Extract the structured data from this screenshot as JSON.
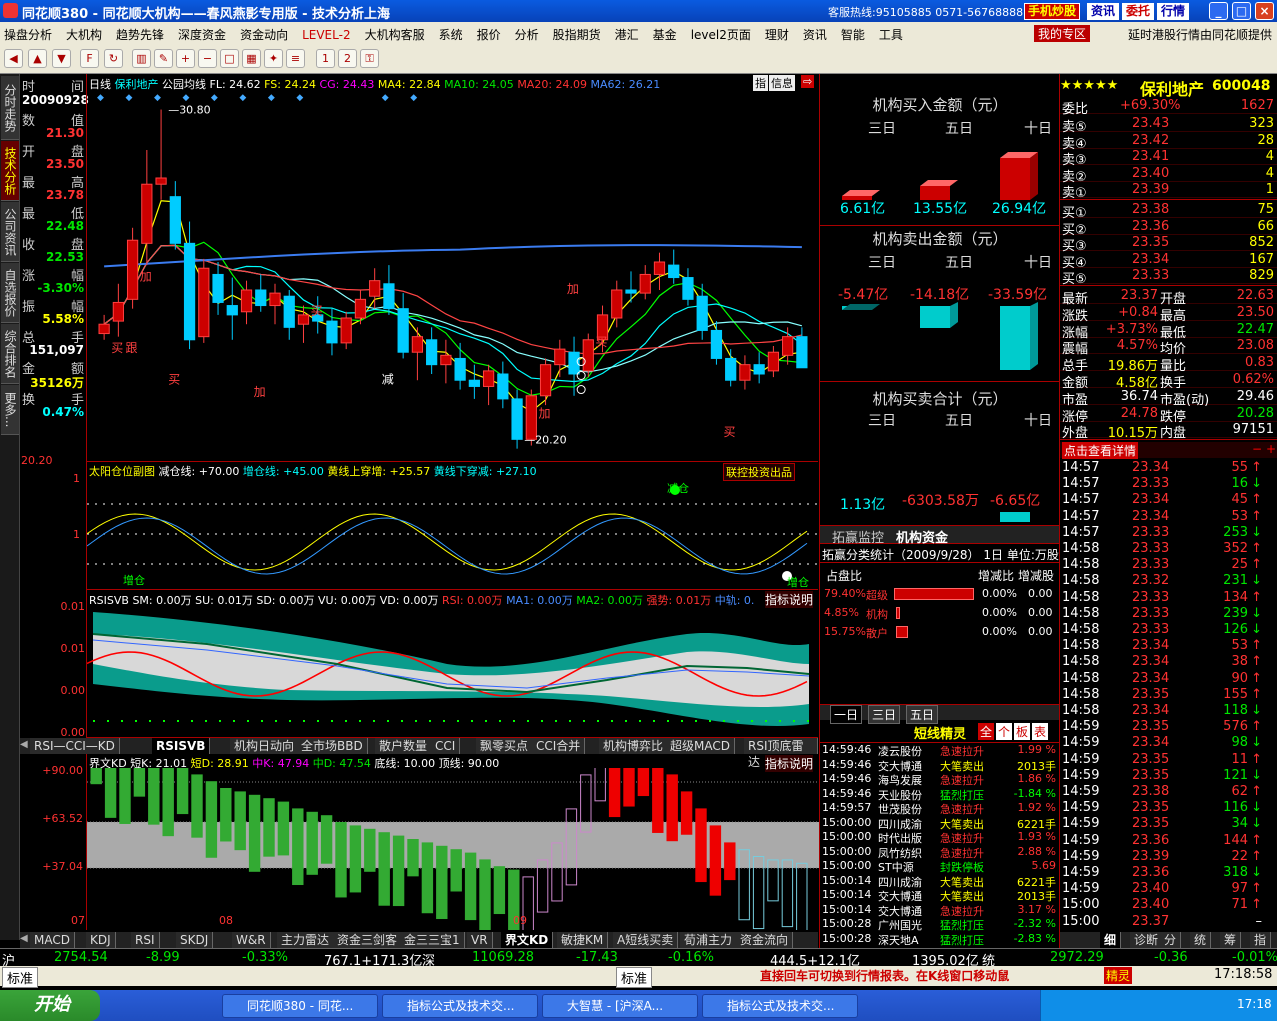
{
  "window": {
    "title": "同花顺380 - 同花顺大机构——春风燕影专用版 - 技术分析上海",
    "hotline": "客服热线:95105885 0571-56768888",
    "btn_phone": "手机炒股",
    "btn_news": "资讯",
    "btn_commission": "委托",
    "btn_quote": "行情",
    "min": "_",
    "max": "□",
    "close": "×"
  },
  "menu": {
    "items": [
      "操盘分析",
      "大机构",
      "趋势先锋",
      "深度资金",
      "资金动向",
      "LEVEL-2",
      "大机构客服",
      "系统",
      "报价",
      "分析",
      "股指期货",
      "港汇",
      "基金",
      "level2页面",
      "理财",
      "资讯",
      "智能",
      "工具"
    ],
    "my_area": "我的专区",
    "right_note": "延时港股行情由同花顺提供"
  },
  "left_tabs": [
    "分时走势",
    "技术分析",
    "公司资讯",
    "自选报价",
    "综合排名",
    "更多..."
  ],
  "info": {
    "date_label_l": "时",
    "date_label_r": "间",
    "date": "20090928",
    "rows": [
      {
        "l": "数",
        "r": "值",
        "v": "21.30"
      },
      {
        "l": "开",
        "r": "盘",
        "v": "23.50"
      },
      {
        "l": "最",
        "r": "高",
        "v": "23.78"
      },
      {
        "l": "最",
        "r": "低",
        "v": "22.48"
      },
      {
        "l": "收",
        "r": "盘",
        "v": "22.53"
      },
      {
        "l": "涨",
        "r": "幅",
        "v": "-3.30%"
      },
      {
        "l": "振",
        "r": "幅",
        "v": "5.58%"
      },
      {
        "l": "总",
        "r": "手",
        "v": "151,097"
      },
      {
        "l": "金",
        "r": "额",
        "v": "35126万"
      },
      {
        "l": "换",
        "r": "手",
        "v": "0.47%"
      }
    ]
  },
  "chart": {
    "period": "日线",
    "stock": "保利地产",
    "indicator": "公园均线",
    "fl": "FL: 24.62",
    "fs": "FS: 24.24",
    "cg": "CG: 24.43",
    "ma4": "MA4: 22.84",
    "ma10": "MA10: 24.05",
    "ma20": "MA20: 24.09",
    "ma62": "MA62: 26.21",
    "btn_index": "指",
    "btn_info": "信息",
    "high_label": "30.80",
    "low_label": "20.20",
    "axis_low": "20.20",
    "markers": [
      "买",
      "跟",
      "加",
      "买",
      "加",
      "买",
      "减",
      "加",
      "加",
      "买",
      "买"
    ]
  },
  "sub1": {
    "title": "太阳仓位副图",
    "jian": "减仓线: +70.00",
    "zeng": "增仓线: +45.00",
    "up": "黄线上穿增: +25.57",
    "down": "黄线下穿减: +27.10",
    "product": "联控投资出品",
    "y_top": "1",
    "y_mid": "1",
    "tag1": "增仓",
    "tag2": "减仓",
    "tag3": "增仓"
  },
  "sub2": {
    "title": "RSISVB",
    "sm": "SM: 0.00万",
    "su": "SU: 0.01万",
    "sd": "SD: 0.00万",
    "vu": "VU: 0.00万",
    "vd": "VD: 0.00万",
    "rsi": "RSI: 0.00万",
    "ma1": "MA1: 0.00万",
    "ma2": "MA2: 0.00万",
    "strong": "强势: 0.01万",
    "mid": "中轨: 0.",
    "help": "指标说明",
    "y": [
      "0.01",
      "0.01",
      "0.00",
      "0.00"
    ]
  },
  "tabs1": [
    "RSI—CCI—KD",
    "RSISVB",
    "机构日动向",
    "全市场BBD",
    "散户数量",
    "CCI",
    "飘零买点",
    "CCI合并",
    "机构博弈比",
    "超级MACD",
    "RSI顶底雷达"
  ],
  "sub3": {
    "title": "界文KD",
    "k": "短K: 21.01",
    "d": "短D: 28.91",
    "mk": "中K: 47.94",
    "md": "中D: 47.54",
    "floor": "底线: 10.00",
    "top": "顶线: 90.00",
    "help": "指标说明",
    "y": [
      "+90.00",
      "+63.52",
      "+37.04"
    ],
    "x": [
      "07",
      "08",
      "09"
    ]
  },
  "tabs2": [
    "MACD",
    "KDJ",
    "RSI",
    "SKDJ",
    "W&R",
    "主力雷达",
    "资金三剑客",
    "金三三宝1",
    "VR",
    "界文KD",
    "敏捷KM",
    "A短线买卖",
    "荀浦主力",
    "资金流向"
  ],
  "middle": {
    "buy_title": "机构买入金额（元）",
    "sell_title": "机构卖出金额（元）",
    "net_title": "机构买卖合计（元）",
    "heads": [
      "三日",
      "五日",
      "十日"
    ],
    "buy": [
      "6.61亿",
      "13.55亿",
      "26.94亿"
    ],
    "sell": [
      "-5.47亿",
      "-14.18亿",
      "-33.59亿"
    ],
    "net": [
      "1.13亿",
      "-6303.58万",
      "-6.65亿"
    ],
    "tab_a": "拓赢监控",
    "tab_b": "机构资金",
    "stat_title": "拓赢分类统计（2009/9/28）",
    "stat_day": "1日",
    "stat_unit": "单位:",
    "stat_unit_v": "万股",
    "col_a": "占盘比",
    "col_b": "增减比",
    "col_c": "增减股",
    "rows": [
      {
        "p": "79.40%",
        "n": "超级",
        "b": "0.00%",
        "c": "0.00"
      },
      {
        "p": "4.85%",
        "n": "机构",
        "b": "0.00%",
        "c": "0.00"
      },
      {
        "p": "15.75%",
        "n": "散户",
        "b": "0.00%",
        "c": "0.00"
      }
    ],
    "dtabs": [
      "一日",
      "三日",
      "五日"
    ],
    "short_title": "短线精灵",
    "short_btns": [
      "全",
      "个",
      "板",
      "表"
    ],
    "short": [
      {
        "t": "14:59:46",
        "n": "凌云股份",
        "a": "急速拉升",
        "v": "1.99 %"
      },
      {
        "t": "14:59:46",
        "n": "交大博通",
        "a": "大笔卖出",
        "v": "2013手"
      },
      {
        "t": "14:59:46",
        "n": "海鸟发展",
        "a": "急速拉升",
        "v": "1.86 %"
      },
      {
        "t": "14:59:46",
        "n": "天业股份",
        "a": "猛烈打压",
        "v": "-1.84 %"
      },
      {
        "t": "14:59:57",
        "n": "世茂股份",
        "a": "急速拉升",
        "v": "1.92 %"
      },
      {
        "t": "15:00:00",
        "n": "四川成渝",
        "a": "大笔卖出",
        "v": "6221手"
      },
      {
        "t": "15:00:00",
        "n": "时代出版",
        "a": "急速拉升",
        "v": "1.93 %"
      },
      {
        "t": "15:00:00",
        "n": "凤竹纺织",
        "a": "急速拉升",
        "v": "2.88 %"
      },
      {
        "t": "15:00:00",
        "n": "ST中源",
        "a": "封跌停板",
        "v": "5.69"
      },
      {
        "t": "15:00:14",
        "n": "四川成渝",
        "a": "大笔卖出",
        "v": "6221手"
      },
      {
        "t": "15:00:14",
        "n": "交大博通",
        "a": "大笔卖出",
        "v": "2013手"
      },
      {
        "t": "15:00:14",
        "n": "交大博通",
        "a": "急速拉升",
        "v": "3.17 %"
      },
      {
        "t": "15:00:28",
        "n": "广州国光",
        "a": "猛烈打压",
        "v": "-2.32 %"
      },
      {
        "t": "15:00:28",
        "n": "深天地A",
        "a": "猛烈打压",
        "v": "-2.83 %"
      }
    ]
  },
  "right": {
    "stars": "★★★★★",
    "name": "保利地产",
    "code": "600048",
    "weibi_l": "委比",
    "weibi_v": "+69.30%",
    "weibi_n": "1627",
    "sell": [
      {
        "l": "卖⑤",
        "p": "23.43",
        "v": "323"
      },
      {
        "l": "卖④",
        "p": "23.42",
        "v": "28"
      },
      {
        "l": "卖③",
        "p": "23.41",
        "v": "4"
      },
      {
        "l": "卖②",
        "p": "23.40",
        "v": "4"
      },
      {
        "l": "卖①",
        "p": "23.39",
        "v": "1"
      }
    ],
    "buy": [
      {
        "l": "买①",
        "p": "23.38",
        "v": "75"
      },
      {
        "l": "买②",
        "p": "23.36",
        "v": "66"
      },
      {
        "l": "买③",
        "p": "23.35",
        "v": "852"
      },
      {
        "l": "买④",
        "p": "23.34",
        "v": "167"
      },
      {
        "l": "买⑤",
        "p": "23.33",
        "v": "829"
      }
    ],
    "stats": [
      {
        "a": "最新",
        "b": "23.37",
        "c": "开盘",
        "d": "22.63"
      },
      {
        "a": "涨跌",
        "b": "+0.84",
        "c": "最高",
        "d": "23.50"
      },
      {
        "a": "涨幅",
        "b": "+3.73%",
        "c": "最低",
        "d": "22.47"
      },
      {
        "a": "震幅",
        "b": "4.57%",
        "c": "均价",
        "d": "23.08"
      },
      {
        "a": "总手",
        "b": "19.86万",
        "c": "量比",
        "d": "0.83"
      },
      {
        "a": "金额",
        "b": "4.58亿",
        "c": "换手",
        "d": "0.62%"
      },
      {
        "a": "市盈",
        "b": "36.74",
        "c": "市盈(动)",
        "d": "29.46"
      },
      {
        "a": "涨停",
        "b": "24.78",
        "c": "跌停",
        "d": "20.28"
      },
      {
        "a": "外盘",
        "b": "10.15万",
        "c": "内盘",
        "d": "97151"
      }
    ],
    "detail_btn": "点击查看详情",
    "ticks": [
      {
        "t": "14:57",
        "p": "23.34",
        "v": "55",
        "d": "up"
      },
      {
        "t": "14:57",
        "p": "23.33",
        "v": "16",
        "d": "dn"
      },
      {
        "t": "14:57",
        "p": "23.34",
        "v": "45",
        "d": "up"
      },
      {
        "t": "14:57",
        "p": "23.34",
        "v": "53",
        "d": "up"
      },
      {
        "t": "14:57",
        "p": "23.33",
        "v": "253",
        "d": "dn"
      },
      {
        "t": "14:58",
        "p": "23.33",
        "v": "352",
        "d": "up"
      },
      {
        "t": "14:58",
        "p": "23.33",
        "v": "25",
        "d": "up"
      },
      {
        "t": "14:58",
        "p": "23.32",
        "v": "231",
        "d": "dn"
      },
      {
        "t": "14:58",
        "p": "23.33",
        "v": "134",
        "d": "up"
      },
      {
        "t": "14:58",
        "p": "23.33",
        "v": "239",
        "d": "dn"
      },
      {
        "t": "14:58",
        "p": "23.33",
        "v": "126",
        "d": "dn"
      },
      {
        "t": "14:58",
        "p": "23.34",
        "v": "53",
        "d": "up"
      },
      {
        "t": "14:58",
        "p": "23.34",
        "v": "38",
        "d": "up"
      },
      {
        "t": "14:58",
        "p": "23.34",
        "v": "90",
        "d": "up"
      },
      {
        "t": "14:58",
        "p": "23.35",
        "v": "155",
        "d": "up"
      },
      {
        "t": "14:58",
        "p": "23.34",
        "v": "118",
        "d": "dn"
      },
      {
        "t": "14:59",
        "p": "23.35",
        "v": "576",
        "d": "up"
      },
      {
        "t": "14:59",
        "p": "23.34",
        "v": "98",
        "d": "dn"
      },
      {
        "t": "14:59",
        "p": "23.35",
        "v": "11",
        "d": "up"
      },
      {
        "t": "14:59",
        "p": "23.35",
        "v": "121",
        "d": "dn"
      },
      {
        "t": "14:59",
        "p": "23.38",
        "v": "62",
        "d": "up"
      },
      {
        "t": "14:59",
        "p": "23.35",
        "v": "116",
        "d": "dn"
      },
      {
        "t": "14:59",
        "p": "23.35",
        "v": "34",
        "d": "dn"
      },
      {
        "t": "14:59",
        "p": "23.36",
        "v": "144",
        "d": "up"
      },
      {
        "t": "14:59",
        "p": "23.39",
        "v": "22",
        "d": "up"
      },
      {
        "t": "14:59",
        "p": "23.36",
        "v": "318",
        "d": "dn"
      },
      {
        "t": "14:59",
        "p": "23.40",
        "v": "97",
        "d": "up"
      },
      {
        "t": "15:00",
        "p": "23.40",
        "v": "71",
        "d": "up"
      },
      {
        "t": "15:00",
        "p": "23.37",
        "v": "",
        "d": "dash"
      }
    ],
    "btabs": [
      "细",
      "诊断",
      "分",
      "统",
      "筹",
      "指"
    ]
  },
  "status": {
    "sh_label": "沪",
    "sh_idx": "2754.54",
    "sh_chg": "-8.99",
    "sh_pct": "-0.33%",
    "sh_vol": "767.1+171.3亿",
    "sz_label": "深",
    "sz_idx": "11069.28",
    "sz_chg": "-17.43",
    "sz_pct": "-0.16%",
    "sz_vol": "444.5+12.1亿",
    "tong_idx": "1395.02亿",
    "tong_label": "统",
    "tong_v": "2972.29",
    "tong_chg": "-0.36",
    "tong_pct": "-0.01%"
  },
  "bottom": {
    "std1": "标准",
    "std2": "标准",
    "marquee": "直接回车可切换到行情报表。在K线窗口移动鼠",
    "jinling": "精灵",
    "time": "17:18:58"
  },
  "taskbar": {
    "start": "开始",
    "tasks": [
      "同花顺380 - 同花...",
      "指标公式及技术交...",
      "大智慧 - [沪深A...",
      "指标公式及技术交..."
    ],
    "clock": "17:18"
  }
}
